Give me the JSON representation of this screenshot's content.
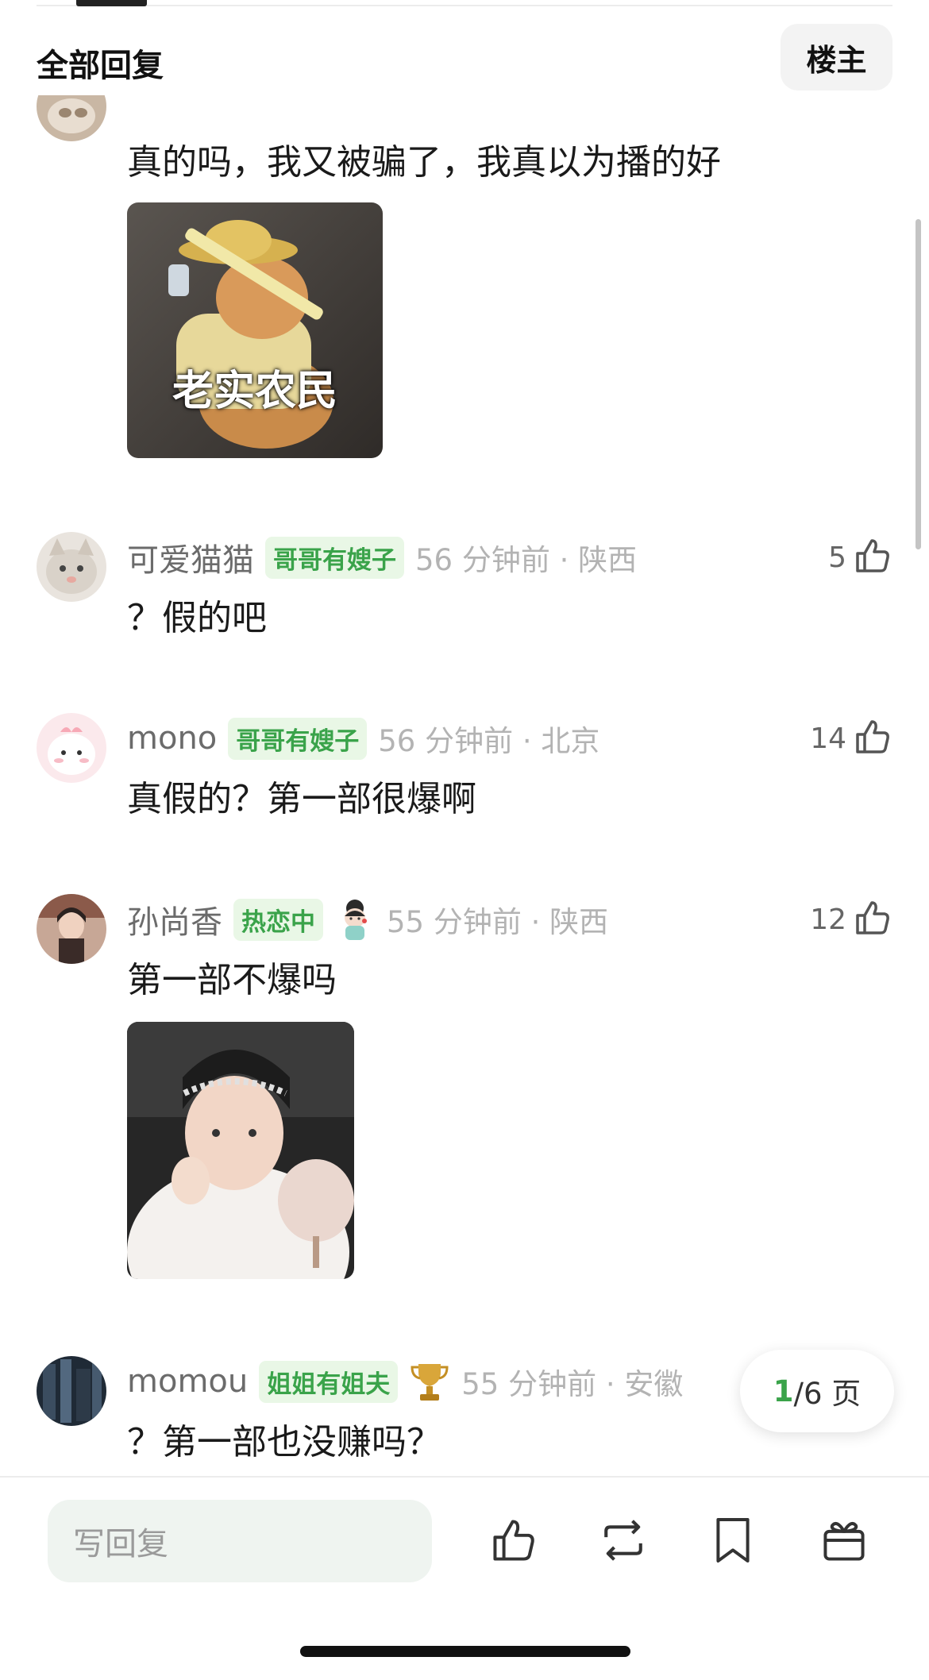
{
  "header": {
    "title": "全部回复",
    "owner_button": "楼主"
  },
  "comments": [
    {
      "text": "真的吗，我又被骗了，我真以为播的好",
      "image_caption": "老实农民"
    },
    {
      "username": "可爱猫猫",
      "badge": "哥哥有嫂子",
      "time": "56 分钟前 · 陕西",
      "likes": "5",
      "text": "？假的吧"
    },
    {
      "username": "mono",
      "badge": "哥哥有嫂子",
      "time": "56 分钟前 · 北京",
      "likes": "14",
      "text": "真假的？第一部很爆啊"
    },
    {
      "username": "孙尚香",
      "badge": "热恋中",
      "time": "55 分钟前 · 陕西",
      "likes": "12",
      "text": "第一部不爆吗"
    },
    {
      "username": "momou",
      "badge": "姐姐有姐夫",
      "time": "55 分钟前 · 安徽",
      "text": "？第一部也没赚吗？"
    }
  ],
  "pager": {
    "current": "1",
    "rest": "/6 页"
  },
  "reply": {
    "placeholder": "写回复"
  },
  "icons": [
    "like-icon",
    "repost-icon",
    "bookmark-icon",
    "gift-icon"
  ],
  "colors": {
    "accent": "#3aa34a",
    "badge_bg": "#e9f7e6"
  }
}
